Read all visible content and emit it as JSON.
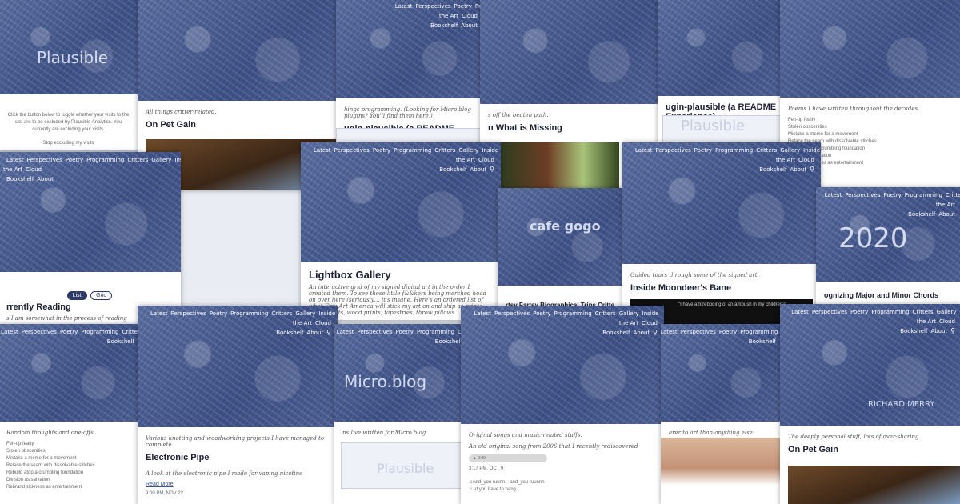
{
  "nav": {
    "line1": [
      "Latest",
      "Perspectives",
      "Poetry",
      "Programming",
      "Critters",
      "Gallery",
      "Inside the Art",
      "Cloud"
    ],
    "line2": [
      "Bookshelf",
      "About"
    ],
    "search_icon": "magnifier-icon"
  },
  "tiles": {
    "plausible_toggle": {
      "art_text": "Plausible",
      "body": "Click the button below to toggle whether your visits to the site are to be excluded by Plausible Analytics. You currently are excluding your visits.",
      "button": "Stop excluding my visits"
    },
    "critters": {
      "desc": "All things critter-related.",
      "title": "On Pet Gain"
    },
    "readme": {
      "desc": "hings programming. (Looking for Micro.blog plugins? You'll find them here.)",
      "title": "ugin-plausible (a README Experience)"
    },
    "perspectives": {
      "desc": "s off the beaten path.",
      "title": "n What is Missing"
    },
    "readme2": {
      "title": "ugin-plausible (a README Experience)",
      "art_text": "Plausible"
    },
    "poetry": {
      "desc": "Poems I have written throughout the decades.",
      "items": [
        "Felt-tip fealty",
        "Stolen obscenities",
        "Mistake a meme for a movement",
        "Relace the seam with dissolvable stitches",
        "Rebuild atop a crumbling foundation",
        "Division as salvation",
        "Rebrand sickness as entertainment"
      ]
    },
    "bookshelf": {
      "toggle_list": "List",
      "toggle_grid": "Grid",
      "title": "rrently Reading",
      "desc": "s I am somewhat in the process of reading"
    },
    "gallery": {
      "title": "Lightbox Gallery",
      "desc": "An interactive grid of my signed digital art in the order I created them. To see these little f&&kers being merched head on over here (seriously… it's insane. Here's an ordered list of what Fine Art America will stick my art on and ship as prints, metal prints, wood prints, tapestries, throw pillows"
    },
    "cloud": {
      "art_text": "cafe gogo",
      "desc": "rtsy Fartsy  Biographical Trips  Critte"
    },
    "inside_art": {
      "desc": "Guided tours through some of the signed art.",
      "title": "Inside Moondeer's Bane",
      "caption": "\"I have a foreboding of an ambush in my children's"
    },
    "music_theory": {
      "art_text": "2020",
      "title": "ognizing Major and Minor Chords"
    },
    "random": {
      "desc": "Random thoughts and one-offs.",
      "items": [
        "Felt-tip fealty",
        "Stolen obscenities",
        "Mistake a meme for a movement",
        "Relace the seam with dissolvable stitches",
        "Rebuild atop a crumbling foundation",
        "Division as salvation",
        "Rebrand sickness as entertainment"
      ]
    },
    "knotting": {
      "desc": "Various knotting and woodworking projects I have managed to complete.",
      "title": "Electronic Pipe",
      "excerpt": "A look at the electronic pipe I made for vaping nicotine",
      "more": "Read More",
      "date": "9:00 PM, NOV 22"
    },
    "microblog": {
      "art_text": "Micro.blog",
      "desc": "ns I've written for Micro.blog.",
      "stats_art": "Plausible"
    },
    "music": {
      "desc": "Original songs and music-related stuffs.",
      "excerpt": "An old original song from 2006 that I recently rediscovered",
      "audio_time": "0:00",
      "date": "3:17 PM, OCT 9",
      "lyrics_1": "♫And_you ruunn---and_you ruunnn",
      "lyrics_2": "♫ ut you have to bang..."
    },
    "art_tile": {
      "desc": "arer to art than anything else."
    },
    "personal": {
      "desc": "The deeply personal stuff, lots of over-sharing.",
      "title": "On Pet Gain",
      "art_text": "RICHARD MERRY"
    }
  },
  "colors": {
    "header_blue": "#4a5c90",
    "title_text": "#1d2033",
    "link_blue": "#3a55a0"
  }
}
